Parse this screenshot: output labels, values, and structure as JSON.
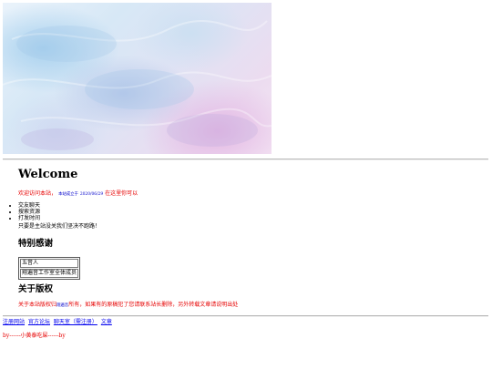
{
  "welcome": {
    "heading": "Welcome",
    "text_before": "欢迎访问本站，",
    "small_blue": "本站成立于",
    "date": "2020/06/29",
    "text_after": "在这里你可以"
  },
  "features": {
    "items": [
      "交友聊天",
      "搜索资源",
      "打发时间"
    ],
    "note": "只要是主站没关我们坚决不跑路！"
  },
  "thanks": {
    "heading": "特别感谢",
    "rows": [
      "五音人",
      "翔遍音工作室全体成员"
    ]
  },
  "copyright": {
    "heading": "关于版权",
    "text_before": "关于本站版权归",
    "small": "翔遍音",
    "text_after": "所有，如果有的原稿犯了您请联系站长删除，另外转载文章请说明出处"
  },
  "footer": {
    "links": [
      "注册网站",
      "官方论坛",
      "聊天室（需注册）",
      "文章"
    ]
  },
  "signature": "by------小黄泰吃屎------by",
  "colors": {
    "accent_red": "#e60000",
    "link_blue": "#0000ee"
  }
}
